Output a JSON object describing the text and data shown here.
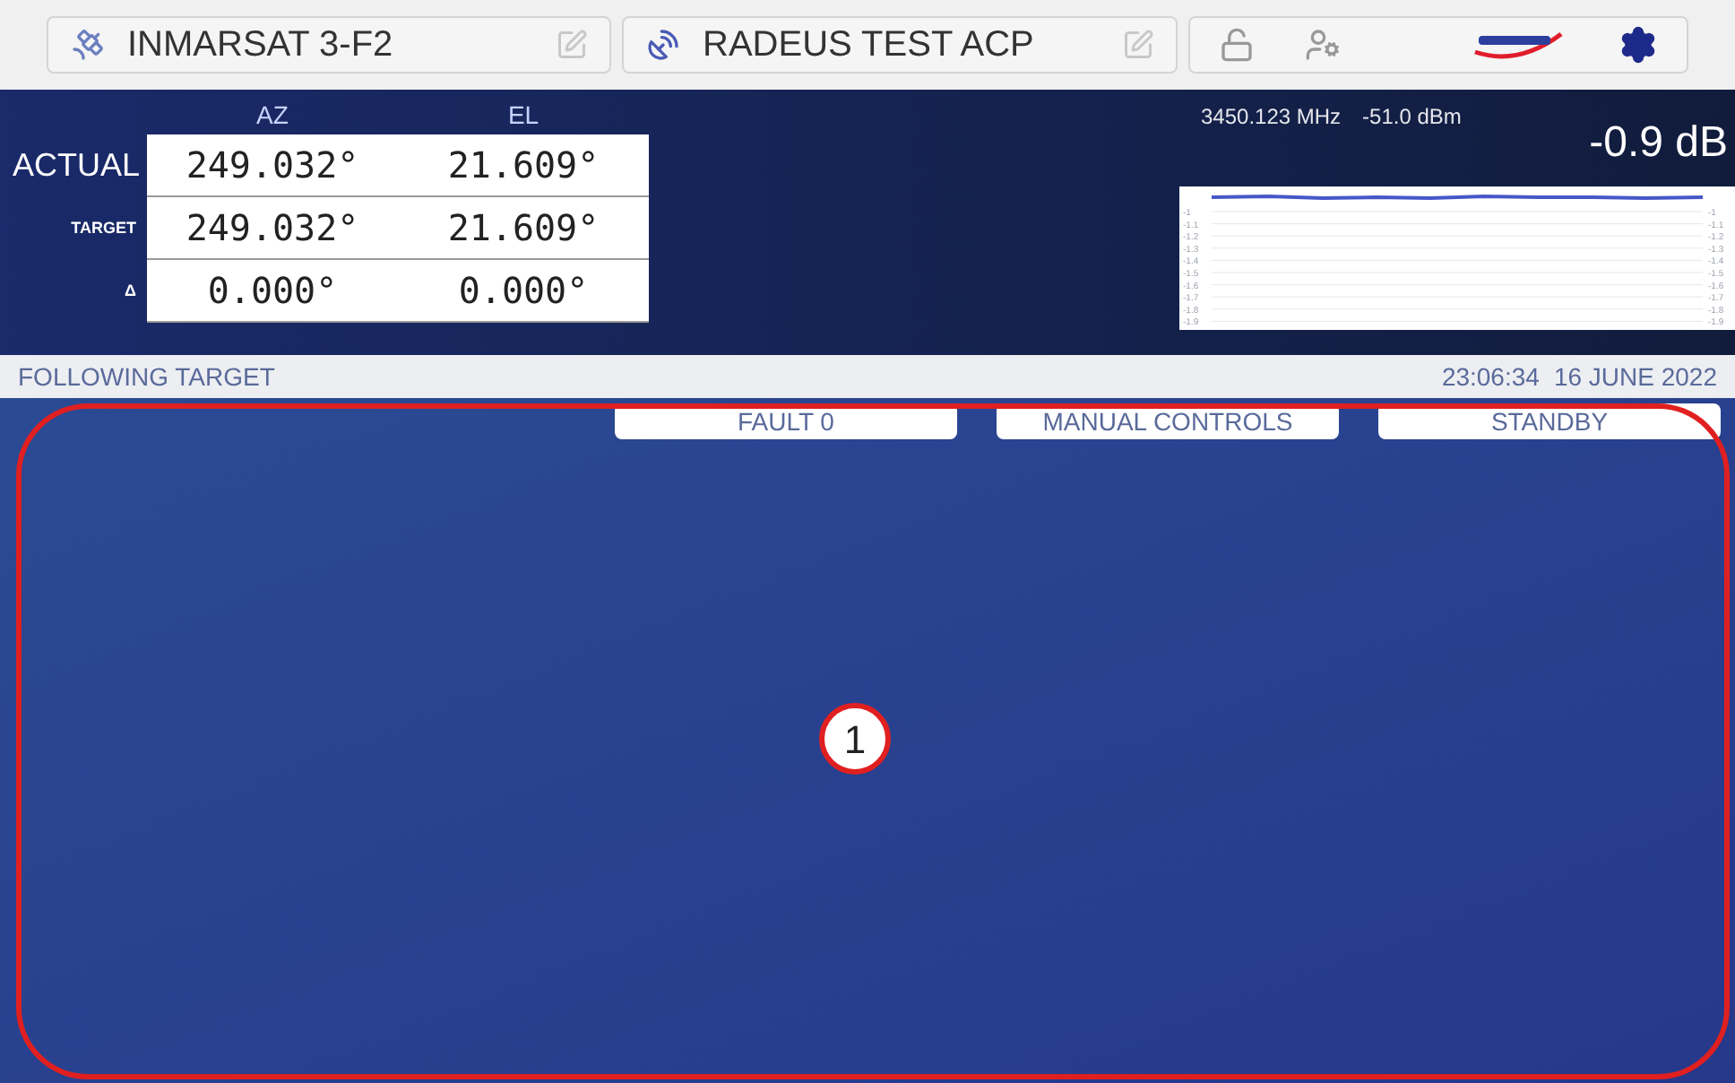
{
  "toolbar": {
    "satellite": "INMARSAT 3-F2",
    "antenna": "RADEUS TEST ACP",
    "locked": false
  },
  "position": {
    "columns": [
      "AZ",
      "EL"
    ],
    "rows": [
      {
        "label": "ACTUAL",
        "kind": "large",
        "values": [
          "249.032°",
          "21.609°"
        ]
      },
      {
        "label": "TARGET",
        "kind": "small",
        "values": [
          "249.032°",
          "21.609°"
        ]
      },
      {
        "label": "Δ",
        "kind": "small",
        "values": [
          "0.000°",
          "0.000°"
        ]
      }
    ]
  },
  "signal": {
    "frequency": "3450.123 MHz",
    "power": "-51.0 dBm",
    "level_reading": "-0.9 dB",
    "trend": {
      "left_scale": [
        "-1",
        "-1.1",
        "-1.2",
        "-1.3",
        "-1.4",
        "-1.5",
        "-1.6",
        "-1.7",
        "-1.8",
        "-1.9"
      ],
      "right_scale": [
        "-1",
        "-1.1",
        "-1.2",
        "-1.3",
        "-1.4",
        "-1.5",
        "-1.6",
        "-1.7",
        "-1.8",
        "-1.9"
      ]
    }
  },
  "status": {
    "mode": "FOLLOWING TARGET",
    "time": "23:06:34",
    "date": "16 JUNE 2022"
  },
  "buttons": [
    "FAULT 0",
    "MANUAL CONTROLS",
    "STANDBY"
  ],
  "callout": {
    "number": "1"
  }
}
